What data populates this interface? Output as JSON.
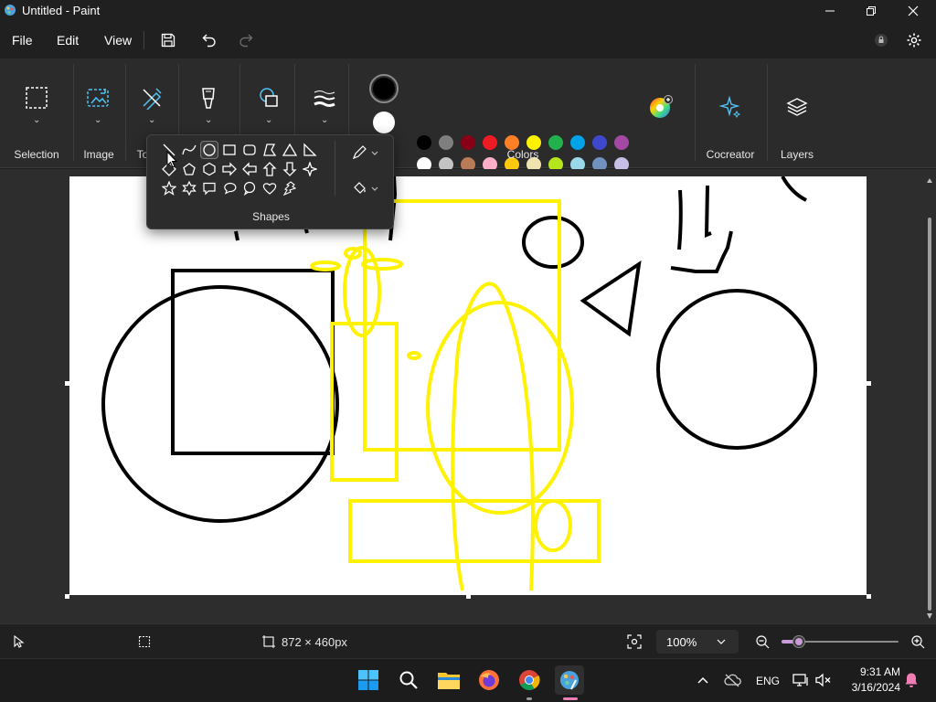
{
  "window": {
    "title": "Untitled - Paint"
  },
  "menu": {
    "file": "File",
    "edit": "Edit",
    "view": "View"
  },
  "ribbon": {
    "groups": {
      "selection": "Selection",
      "image": "Image",
      "tools": "To",
      "colors": "Colors",
      "cocreator": "Cocreator",
      "layers": "Layers"
    },
    "swatch_colors": {
      "row1": [
        "#000000",
        "#7f7f7f",
        "#880015",
        "#ed1c24",
        "#ff7f27",
        "#fff200",
        "#22b14c",
        "#00a2e8",
        "#3f48cc",
        "#a349a4"
      ],
      "row2": [
        "#ffffff",
        "#c3c3c3",
        "#b97a57",
        "#ffaec9",
        "#ffc90e",
        "#efe4b0",
        "#b5e61d",
        "#99d9ea",
        "#7092be",
        "#c8bfe7"
      ]
    },
    "primary_color": "#000000",
    "secondary_color": "#ffffff"
  },
  "shapes_flyout": {
    "label": "Shapes",
    "selected_shape": "oval-shape-icon"
  },
  "canvas": {
    "stroke_colors": {
      "black": "#000000",
      "yellow": "#fff200"
    }
  },
  "status": {
    "canvas_size": "872 × 460px",
    "zoom": "100%"
  },
  "zoom_level": 0.5,
  "taskbar": {
    "language": "ENG",
    "time": "9:31 AM",
    "date": "3/16/2024"
  }
}
